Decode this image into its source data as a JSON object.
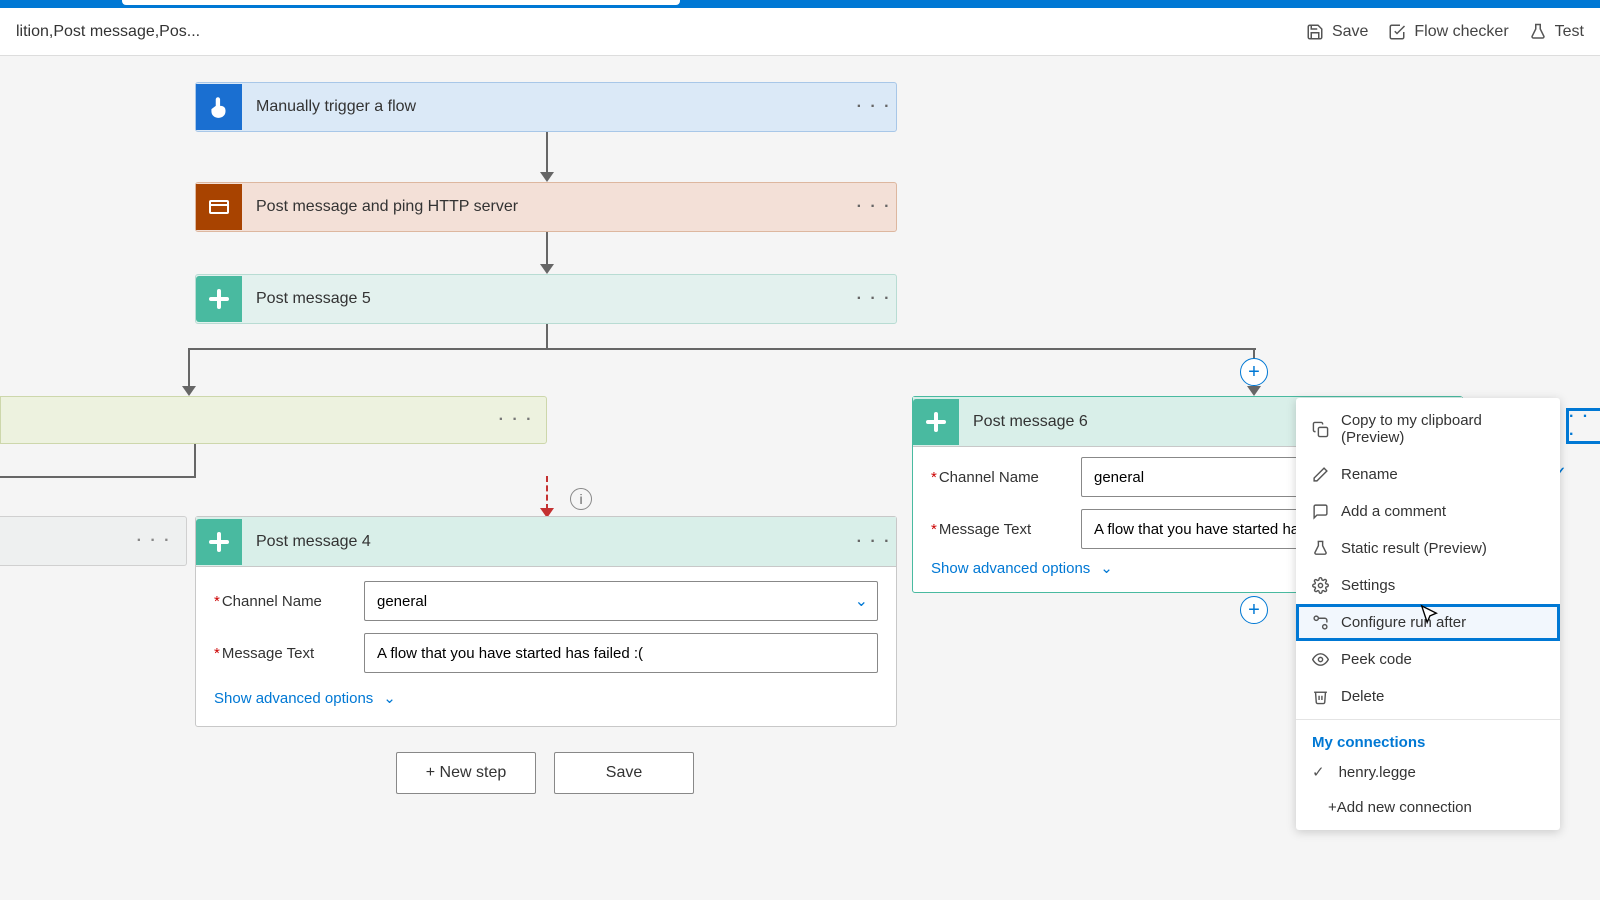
{
  "toolbar": {
    "breadcrumb": "lition,Post message,Pos...",
    "save": "Save",
    "flow_checker": "Flow checker",
    "test": "Test"
  },
  "cards": {
    "trigger": "Manually trigger a flow",
    "http": "Post message and ping HTTP server",
    "msg5": "Post message 5",
    "msg4": "Post message 4",
    "msg6": "Post message 6"
  },
  "form": {
    "channel_label": "Channel Name",
    "channel_value": "general",
    "message_label": "Message Text",
    "message_value_4": "A flow that you have started has failed :(",
    "message_value_6": "A flow that you have started has",
    "show_adv": "Show advanced options"
  },
  "buttons": {
    "new_step": "+ New step",
    "save": "Save"
  },
  "menu": {
    "copy": "Copy to my clipboard (Preview)",
    "rename": "Rename",
    "comment": "Add a comment",
    "static": "Static result (Preview)",
    "settings": "Settings",
    "configure": "Configure run after",
    "peek": "Peek code",
    "delete": "Delete",
    "connections_header": "My connections",
    "connection_name": "henry.legge",
    "add_connection": "+Add new connection"
  }
}
